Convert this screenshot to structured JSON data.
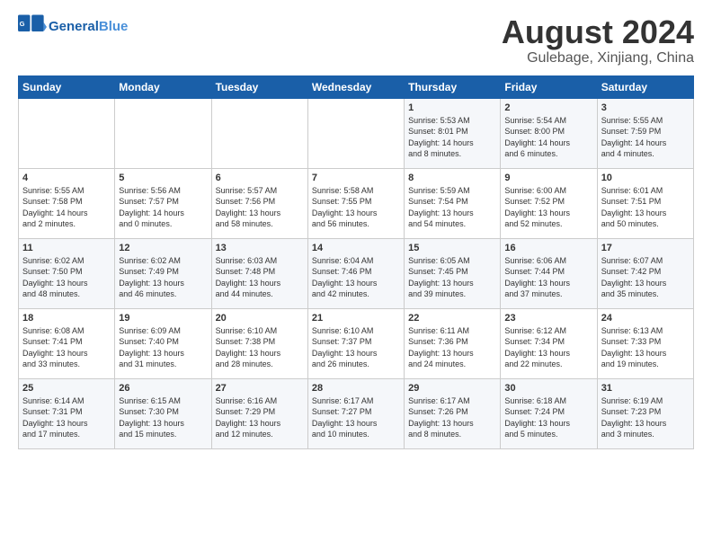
{
  "logo": {
    "text_general": "General",
    "text_blue": "Blue"
  },
  "title": "August 2024",
  "subtitle": "Gulebage, Xinjiang, China",
  "columns": [
    "Sunday",
    "Monday",
    "Tuesday",
    "Wednesday",
    "Thursday",
    "Friday",
    "Saturday"
  ],
  "weeks": [
    [
      {
        "day": "",
        "info": ""
      },
      {
        "day": "",
        "info": ""
      },
      {
        "day": "",
        "info": ""
      },
      {
        "day": "",
        "info": ""
      },
      {
        "day": "1",
        "info": "Sunrise: 5:53 AM\nSunset: 8:01 PM\nDaylight: 14 hours\nand 8 minutes."
      },
      {
        "day": "2",
        "info": "Sunrise: 5:54 AM\nSunset: 8:00 PM\nDaylight: 14 hours\nand 6 minutes."
      },
      {
        "day": "3",
        "info": "Sunrise: 5:55 AM\nSunset: 7:59 PM\nDaylight: 14 hours\nand 4 minutes."
      }
    ],
    [
      {
        "day": "4",
        "info": "Sunrise: 5:55 AM\nSunset: 7:58 PM\nDaylight: 14 hours\nand 2 minutes."
      },
      {
        "day": "5",
        "info": "Sunrise: 5:56 AM\nSunset: 7:57 PM\nDaylight: 14 hours\nand 0 minutes."
      },
      {
        "day": "6",
        "info": "Sunrise: 5:57 AM\nSunset: 7:56 PM\nDaylight: 13 hours\nand 58 minutes."
      },
      {
        "day": "7",
        "info": "Sunrise: 5:58 AM\nSunset: 7:55 PM\nDaylight: 13 hours\nand 56 minutes."
      },
      {
        "day": "8",
        "info": "Sunrise: 5:59 AM\nSunset: 7:54 PM\nDaylight: 13 hours\nand 54 minutes."
      },
      {
        "day": "9",
        "info": "Sunrise: 6:00 AM\nSunset: 7:52 PM\nDaylight: 13 hours\nand 52 minutes."
      },
      {
        "day": "10",
        "info": "Sunrise: 6:01 AM\nSunset: 7:51 PM\nDaylight: 13 hours\nand 50 minutes."
      }
    ],
    [
      {
        "day": "11",
        "info": "Sunrise: 6:02 AM\nSunset: 7:50 PM\nDaylight: 13 hours\nand 48 minutes."
      },
      {
        "day": "12",
        "info": "Sunrise: 6:02 AM\nSunset: 7:49 PM\nDaylight: 13 hours\nand 46 minutes."
      },
      {
        "day": "13",
        "info": "Sunrise: 6:03 AM\nSunset: 7:48 PM\nDaylight: 13 hours\nand 44 minutes."
      },
      {
        "day": "14",
        "info": "Sunrise: 6:04 AM\nSunset: 7:46 PM\nDaylight: 13 hours\nand 42 minutes."
      },
      {
        "day": "15",
        "info": "Sunrise: 6:05 AM\nSunset: 7:45 PM\nDaylight: 13 hours\nand 39 minutes."
      },
      {
        "day": "16",
        "info": "Sunrise: 6:06 AM\nSunset: 7:44 PM\nDaylight: 13 hours\nand 37 minutes."
      },
      {
        "day": "17",
        "info": "Sunrise: 6:07 AM\nSunset: 7:42 PM\nDaylight: 13 hours\nand 35 minutes."
      }
    ],
    [
      {
        "day": "18",
        "info": "Sunrise: 6:08 AM\nSunset: 7:41 PM\nDaylight: 13 hours\nand 33 minutes."
      },
      {
        "day": "19",
        "info": "Sunrise: 6:09 AM\nSunset: 7:40 PM\nDaylight: 13 hours\nand 31 minutes."
      },
      {
        "day": "20",
        "info": "Sunrise: 6:10 AM\nSunset: 7:38 PM\nDaylight: 13 hours\nand 28 minutes."
      },
      {
        "day": "21",
        "info": "Sunrise: 6:10 AM\nSunset: 7:37 PM\nDaylight: 13 hours\nand 26 minutes."
      },
      {
        "day": "22",
        "info": "Sunrise: 6:11 AM\nSunset: 7:36 PM\nDaylight: 13 hours\nand 24 minutes."
      },
      {
        "day": "23",
        "info": "Sunrise: 6:12 AM\nSunset: 7:34 PM\nDaylight: 13 hours\nand 22 minutes."
      },
      {
        "day": "24",
        "info": "Sunrise: 6:13 AM\nSunset: 7:33 PM\nDaylight: 13 hours\nand 19 minutes."
      }
    ],
    [
      {
        "day": "25",
        "info": "Sunrise: 6:14 AM\nSunset: 7:31 PM\nDaylight: 13 hours\nand 17 minutes."
      },
      {
        "day": "26",
        "info": "Sunrise: 6:15 AM\nSunset: 7:30 PM\nDaylight: 13 hours\nand 15 minutes."
      },
      {
        "day": "27",
        "info": "Sunrise: 6:16 AM\nSunset: 7:29 PM\nDaylight: 13 hours\nand 12 minutes."
      },
      {
        "day": "28",
        "info": "Sunrise: 6:17 AM\nSunset: 7:27 PM\nDaylight: 13 hours\nand 10 minutes."
      },
      {
        "day": "29",
        "info": "Sunrise: 6:17 AM\nSunset: 7:26 PM\nDaylight: 13 hours\nand 8 minutes."
      },
      {
        "day": "30",
        "info": "Sunrise: 6:18 AM\nSunset: 7:24 PM\nDaylight: 13 hours\nand 5 minutes."
      },
      {
        "day": "31",
        "info": "Sunrise: 6:19 AM\nSunset: 7:23 PM\nDaylight: 13 hours\nand 3 minutes."
      }
    ]
  ]
}
